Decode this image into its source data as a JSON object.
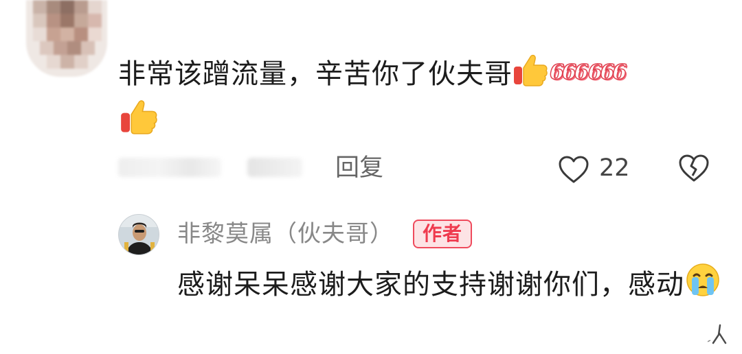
{
  "comment": {
    "avatar_alt": "pixelated-avatar",
    "text_main": "非常该蹭流量，辛苦你了伙夫哥",
    "badge_six_1": "666",
    "badge_six_2": "666",
    "reply_label": "回复",
    "like_count": "22",
    "icons": {
      "thumbs_up": "thumbs-up-icon",
      "like": "heart-outline-icon",
      "dislike": "broken-heart-icon"
    }
  },
  "reply": {
    "author_name": "非黎莫属（伙夫哥）",
    "author_badge": "作者",
    "text": "感谢呆呆感谢大家的支持谢谢你们，感动",
    "icons": {
      "emoji": "crying-face-icon"
    }
  },
  "colors": {
    "badge_red": "#ef4a5c",
    "text_primary": "#1c1c1c",
    "text_secondary": "#888888",
    "emoji_yellow": "#ffcc33"
  }
}
